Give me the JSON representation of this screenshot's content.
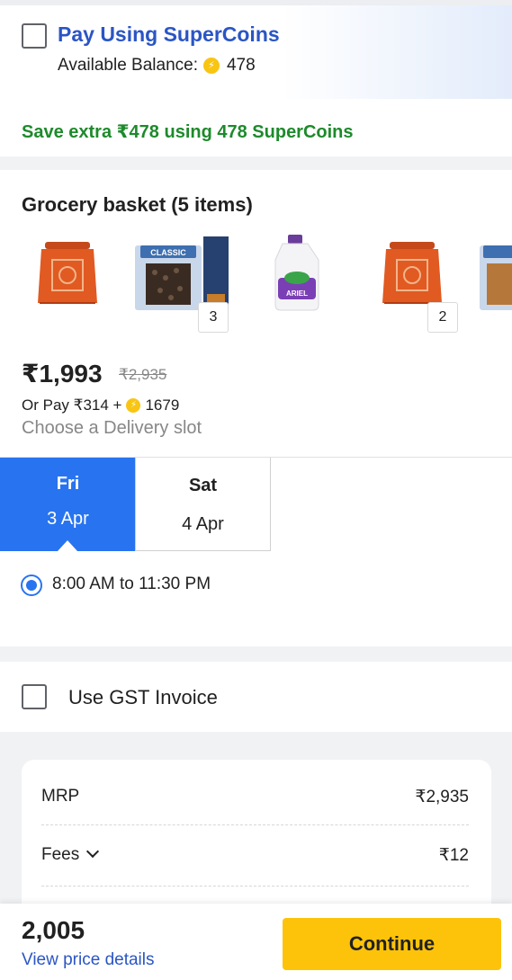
{
  "supercoins": {
    "title": "Pay Using SuperCoins",
    "balance_label": "Available Balance:",
    "balance_value": "478",
    "save_text": "Save extra ₹478 using 478 SuperCoins",
    "coin_icon": "supercoin-icon",
    "checked": false
  },
  "basket": {
    "title": "Grocery basket (5 items)",
    "items": [
      {
        "name": "orange-grocery-bag",
        "qty": ""
      },
      {
        "name": "classic-black-raisins-pack",
        "qty": "3"
      },
      {
        "name": "ariel-detergent-bottle",
        "qty": ""
      },
      {
        "name": "orange-grocery-bag",
        "qty": "2"
      },
      {
        "name": "classic-pack-partial",
        "qty": ""
      }
    ],
    "pack_brand": "CLASSIC",
    "detergent_brand": "ARIEL",
    "price": "₹1,993",
    "mrp": "₹2,935",
    "or_pay_prefix": "Or Pay ₹314 +",
    "or_pay_coins": "1679",
    "delivery_prompt": "Choose a Delivery slot"
  },
  "slots": {
    "days": [
      {
        "day": "Fri",
        "date": "3 Apr",
        "selected": true
      },
      {
        "day": "Sat",
        "date": "4 Apr",
        "selected": false
      }
    ],
    "time": "8:00 AM to 11:30 PM"
  },
  "gst": {
    "label": "Use GST Invoice",
    "checked": false
  },
  "price_details": {
    "rows": [
      {
        "label": "MRP",
        "value": "₹2,935"
      },
      {
        "label": "Fees",
        "value": "₹12"
      }
    ]
  },
  "footer": {
    "total": "2,005",
    "view_details": "View price details",
    "continue_label": "Continue"
  },
  "colors": {
    "accent_blue": "#2874f0",
    "link_blue": "#2a55c5",
    "save_green": "#1d8a2b",
    "continue_yellow": "#fdc30a",
    "coin_yellow": "#f9c513"
  }
}
